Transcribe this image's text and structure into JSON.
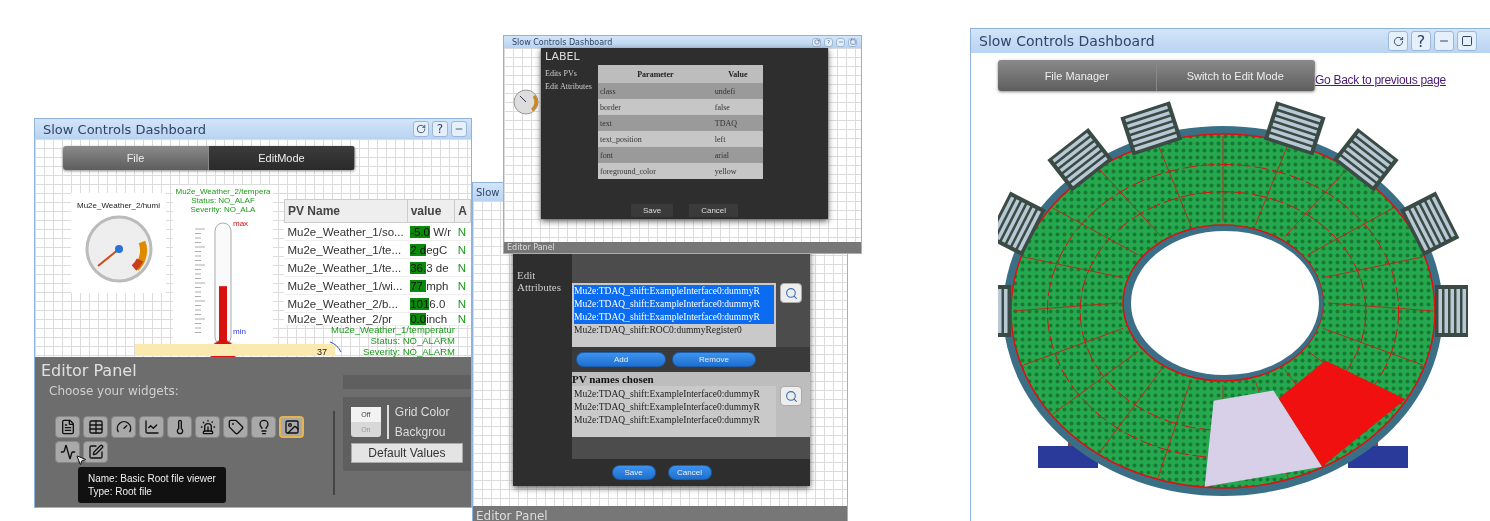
{
  "left_dashboard": {
    "title": "Slow Controls Dashboard",
    "help": "?",
    "tabs": [
      {
        "label": "File",
        "selected": false
      },
      {
        "label": "EditMode",
        "selected": true
      }
    ],
    "gauge": {
      "label": "Mu2e_Weather_2/humi"
    },
    "thermometer": {
      "lines": [
        "Mu2e_Weather_2/tempera",
        "Status: NO_ALAF",
        "Severity: NO_ALA"
      ],
      "max": "max",
      "min": "min",
      "level": 0.48
    },
    "table": {
      "columns": [
        "PV Name",
        "value",
        "A"
      ],
      "rows": [
        {
          "name": "Mu2e_Weather_1/so...",
          "value_hi": "-5.0",
          "value_rest": " W/r",
          "alarm": "N"
        },
        {
          "name": "Mu2e_Weather_1/te...",
          "value_hi": "2 d",
          "value_rest": "egC",
          "alarm": "N"
        },
        {
          "name": "Mu2e_Weather_1/te...",
          "value_hi": "36.",
          "value_rest": "3 de",
          "alarm": "N"
        },
        {
          "name": "Mu2e_Weather_1/wi...",
          "value_hi": "77 ",
          "value_rest": "mph",
          "alarm": "N"
        },
        {
          "name": "Mu2e_Weather_2/b...",
          "value_hi": "101",
          "value_rest": "6.0",
          "alarm": "N"
        },
        {
          "name": "Mu2e_Weather_2/pr",
          "value_hi": "0.0",
          "value_rest": "inch",
          "alarm": "N"
        }
      ]
    },
    "plot": {
      "lines": [
        "Mu2e_Weather_1/temperatur",
        "Status: NO_ALARM",
        "Severity: NO_ALARM"
      ],
      "tick": "37"
    },
    "editor": {
      "title": "Editor Panel",
      "prompt": "Choose your widgets:",
      "widgets": [
        {
          "kind": "text",
          "selected": false
        },
        {
          "kind": "table",
          "selected": false
        },
        {
          "kind": "gauge",
          "selected": false
        },
        {
          "kind": "chart",
          "selected": false
        },
        {
          "kind": "thermometer",
          "selected": false
        },
        {
          "kind": "alarm",
          "selected": false
        },
        {
          "kind": "label",
          "selected": false
        },
        {
          "kind": "led",
          "selected": false
        },
        {
          "kind": "image",
          "selected": true
        },
        {
          "kind": "root",
          "selected": false
        },
        {
          "kind": "edit",
          "selected": false
        }
      ],
      "switch": {
        "off": "Off",
        "on": "On",
        "switched_on": false
      },
      "labels": [
        "Grid Color",
        "Backgrou"
      ],
      "defaults_button": "Default Values",
      "tooltip": [
        "Name: Basic Root file viewer",
        "Type: Root file"
      ]
    }
  },
  "pv_dialog_window": {
    "title": "Slow",
    "side_label": "Edit Attributes",
    "available": [
      {
        "text": "Mu2e:TDAQ_shift:ExampleInterface0:dummyR",
        "selected": true
      },
      {
        "text": "Mu2e:TDAQ_shift:ExampleInterface0:dummyR",
        "selected": true
      },
      {
        "text": "Mu2e:TDAQ_shift:ExampleInterface0:dummyR",
        "selected": true
      },
      {
        "text": "Mu2e:TDAQ_shift:ROC0:dummyRegister0",
        "selected": false
      }
    ],
    "add": "Add",
    "remove": "Remove",
    "chosen_heading": "PV names chosen",
    "chosen": [
      "Mu2e:TDAQ_shift:ExampleInterface0:dummyR",
      "Mu2e:TDAQ_shift:ExampleInterface0:dummyR",
      "Mu2e:TDAQ_shift:ExampleInterface0:dummyR"
    ],
    "save": "Save",
    "cancel": "Cancel",
    "editor_panel": "Editor Panel"
  },
  "label_dialog_window": {
    "title": "Slow Controls Dashboard",
    "help": "?",
    "dialog_title": "LABEL",
    "side_items": [
      "Edits PVs",
      "Edit Attributes"
    ],
    "columns": [
      "Parameter",
      "Value"
    ],
    "rows": [
      {
        "parameter": "class",
        "value": "undefi"
      },
      {
        "parameter": "border",
        "value": "false"
      },
      {
        "parameter": "text",
        "value": "TDAQ"
      },
      {
        "parameter": "text_position",
        "value": "left"
      },
      {
        "parameter": "font",
        "value": "arial"
      },
      {
        "parameter": "foreground_color",
        "value": "yellow"
      }
    ],
    "save": "Save",
    "cancel": "Cancel",
    "editor_panel": "Editor Panel"
  },
  "right_dashboard": {
    "title": "Slow Controls Dashboard",
    "help": "?",
    "tabs": [
      "File Manager",
      "Switch to Edit Mode"
    ],
    "back_link": "Go Back to previous page"
  }
}
